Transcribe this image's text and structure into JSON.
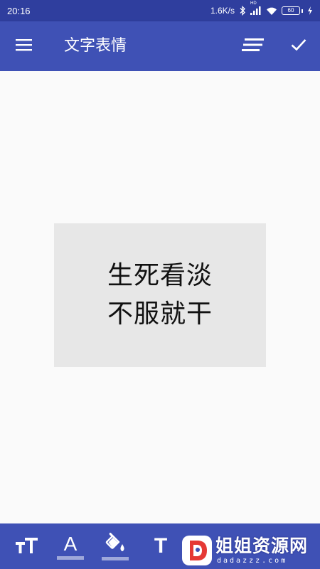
{
  "status_bar": {
    "time": "20:16",
    "network_speed": "1.6K/s",
    "signal_tag": "HD",
    "battery_level": "60",
    "icons": [
      "bluetooth-icon",
      "signal-icon",
      "wifi-icon",
      "battery-icon",
      "charging-icon"
    ]
  },
  "app_bar": {
    "title": "文字表情",
    "icons": [
      "menu-icon",
      "text-align-icon",
      "check-icon"
    ]
  },
  "canvas": {
    "lines": [
      "生死看淡",
      "不服就干"
    ],
    "card_color": "#e7e7e7",
    "text_color": "#111111"
  },
  "toolbar": {
    "tools": [
      {
        "name": "text-size-tool",
        "icon": "text-size-icon"
      },
      {
        "name": "text-color-tool",
        "icon": "text-color-icon",
        "glyph": "A"
      },
      {
        "name": "fill-color-tool",
        "icon": "paint-bucket-icon"
      },
      {
        "name": "font-tool",
        "icon": "font-icon",
        "glyph": "T"
      }
    ]
  },
  "watermark": {
    "title": "姐姐资源网",
    "subtitle": "dadazzz.com"
  },
  "colors": {
    "primary": "#3f51b5",
    "primary_dark": "#2f3e9e",
    "background": "#fafafa",
    "underline_accent": "#9fa8da"
  }
}
